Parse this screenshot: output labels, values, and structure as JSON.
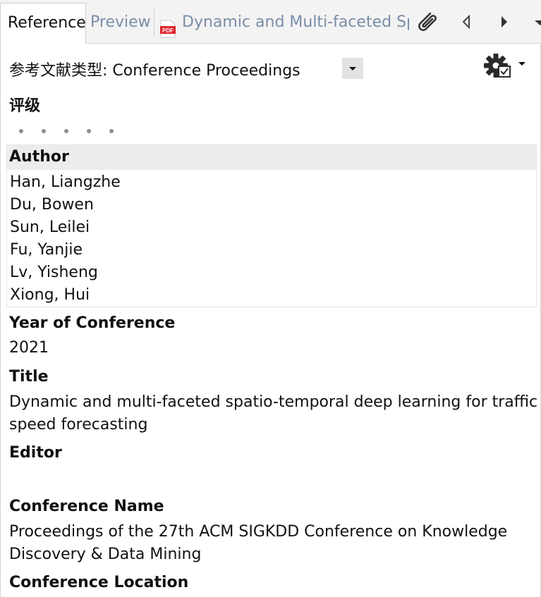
{
  "tabs": {
    "reference": "Reference",
    "preview": "Preview",
    "pdf": "Dynamic and Multi-faceted Spa"
  },
  "reference_type": {
    "label": "参考文献类型: Conference Proceedings"
  },
  "rating": {
    "label": "评级",
    "value": 0,
    "max": 5
  },
  "fields": {
    "author_label": "Author",
    "authors": [
      "Han, Liangzhe",
      "Du, Bowen",
      "Sun, Leilei",
      "Fu, Yanjie",
      "Lv, Yisheng",
      "Xiong, Hui"
    ],
    "year_label": "Year of Conference",
    "year_value": "2021",
    "title_label": "Title",
    "title_line1": "Dynamic and multi-faceted spatio-temporal deep learning for traffic",
    "title_line2": "speed forecasting",
    "editor_label": "Editor",
    "editor_value": "",
    "conf_name_label": "Conference Name",
    "conf_name_line1": "Proceedings of the 27th ACM SIGKDD Conference on Knowledge",
    "conf_name_line2": "Discovery & Data Mining",
    "conf_location_label": "Conference Location"
  },
  "icons": {
    "pdf": "pdf-file-icon",
    "attach": "paperclip-icon",
    "prev": "triangle-left-icon",
    "next": "triangle-right-icon",
    "more": "chevron-down-icon",
    "settings": "gear-icon"
  },
  "colors": {
    "pdf_red": "#e0242b",
    "tab_inactive_text": "#7a8da8"
  }
}
